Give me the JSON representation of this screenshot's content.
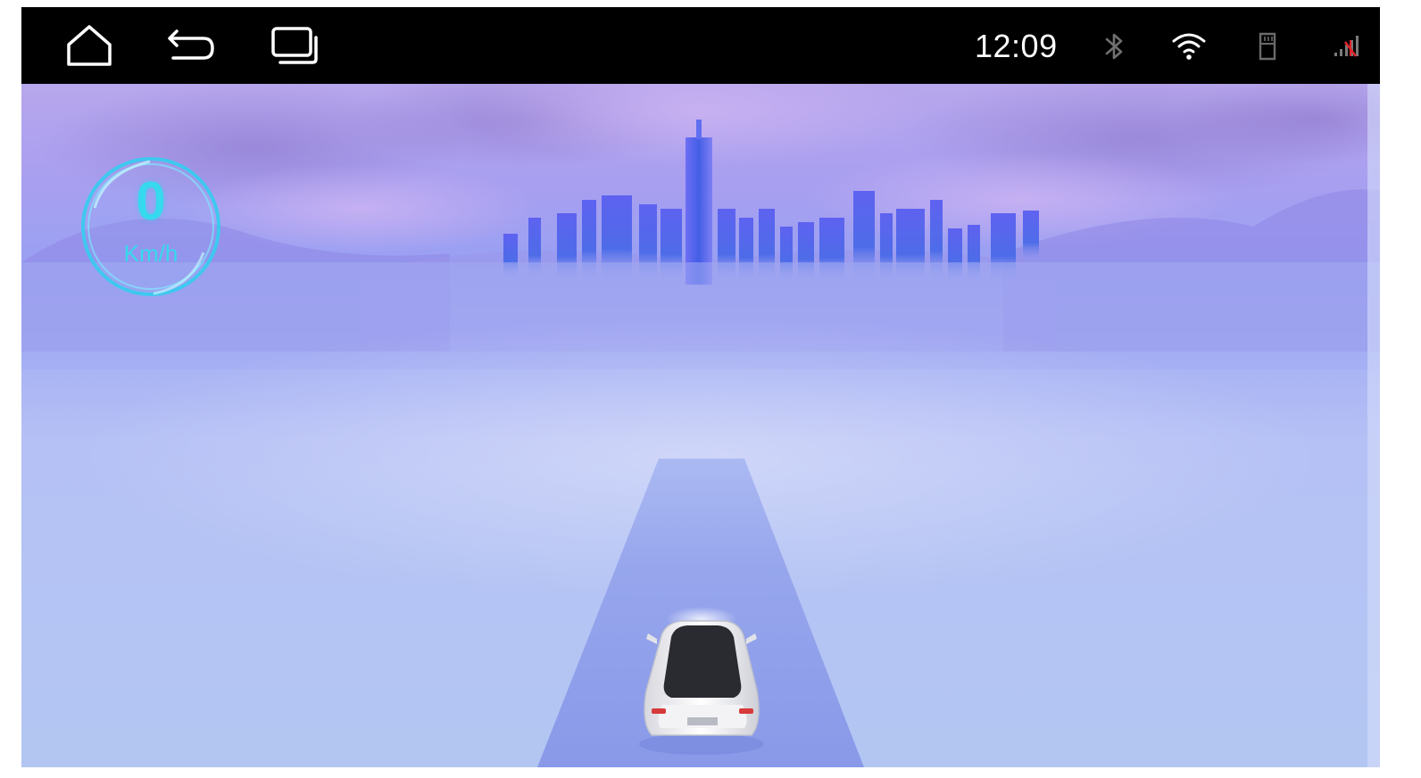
{
  "status_bar": {
    "time": "12:09",
    "icons": [
      "home-icon",
      "back-icon",
      "recents-icon",
      "bluetooth-icon",
      "wifi-icon",
      "sd-card-icon",
      "signal-icon"
    ]
  },
  "speedometer": {
    "value": "0",
    "unit": "Km/h"
  },
  "colors": {
    "status_bar_bg": "#000000",
    "speed_accent": "#36d9ee",
    "road": "#8f9fe8",
    "sky_purple": "#b7a6ec",
    "city": "#5b63e6"
  }
}
